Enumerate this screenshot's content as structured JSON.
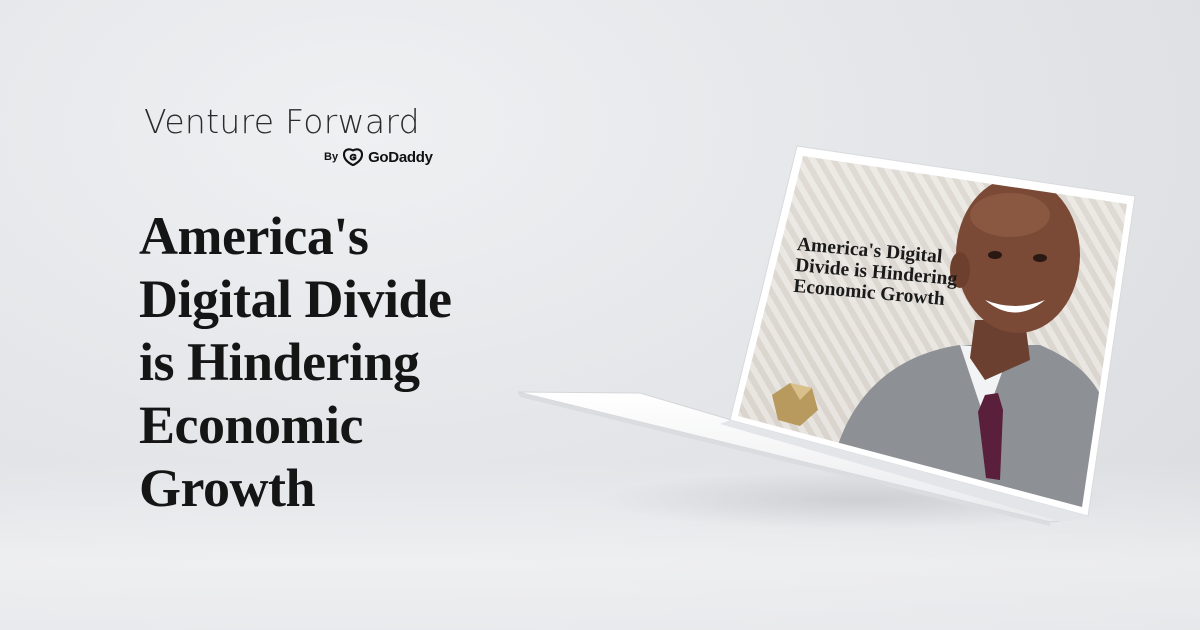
{
  "brand": {
    "title": "Venture Forward",
    "by": "By",
    "company": "GoDaddy",
    "logo_icon": "godaddy-logo-icon"
  },
  "headline": {
    "lines": [
      "America's",
      "Digital Divide",
      "is Hindering",
      "Economic",
      "Growth"
    ]
  },
  "laptop_screen": {
    "headline_lines": [
      "America's Digital",
      "Divide is Hindering",
      "Economic Growth"
    ]
  },
  "colors": {
    "background": "#e4e6e9",
    "headline": "#151515",
    "brand": "#2b2b2b"
  }
}
